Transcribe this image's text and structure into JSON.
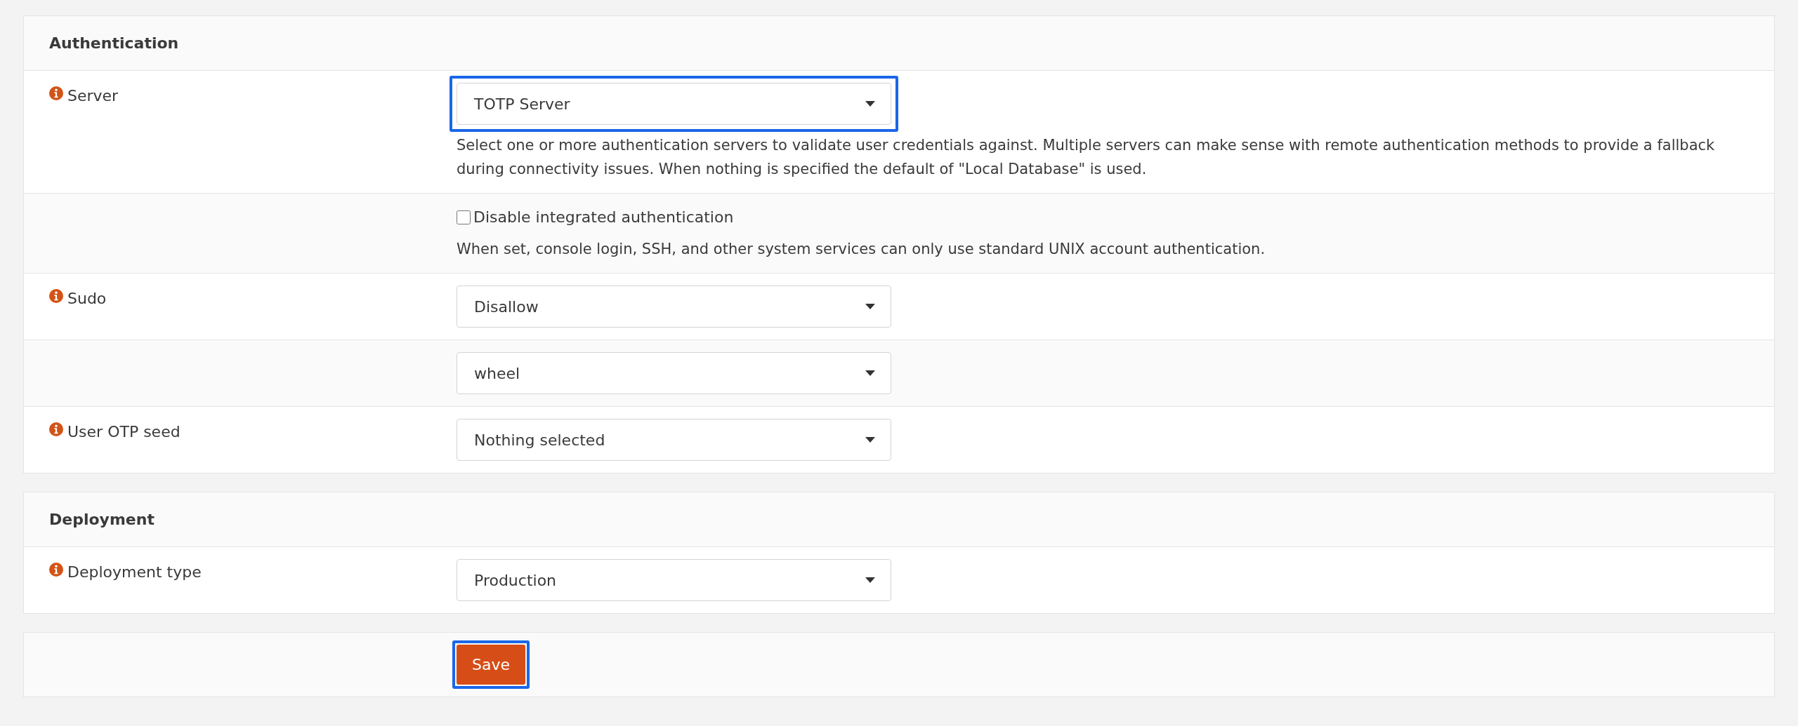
{
  "sections": [
    {
      "title": "Authentication",
      "rows": [
        {
          "kind": "select",
          "label": "Server",
          "value": "TOTP Server",
          "highlighted": true,
          "help": "Select one or more authentication servers to validate user credentials against. Multiple servers can make sense with remote authentication methods to provide a fallback during connectivity issues. When nothing is specified the default of \"Local Database\" is used."
        },
        {
          "kind": "checkbox",
          "checked": false,
          "text": "Disable integrated authentication",
          "help": "When set, console login, SSH, and other system services can only use standard UNIX account authentication."
        },
        {
          "kind": "select",
          "label": "Sudo",
          "value": "Disallow",
          "highlighted": false
        },
        {
          "kind": "select",
          "value": "wheel",
          "highlighted": false
        },
        {
          "kind": "select",
          "label": "User OTP seed",
          "value": "Nothing selected",
          "highlighted": false
        }
      ]
    },
    {
      "title": "Deployment",
      "rows": [
        {
          "kind": "select",
          "label": "Deployment type",
          "value": "Production",
          "highlighted": false
        }
      ]
    }
  ],
  "save_button": {
    "label": "Save",
    "highlighted": true
  }
}
